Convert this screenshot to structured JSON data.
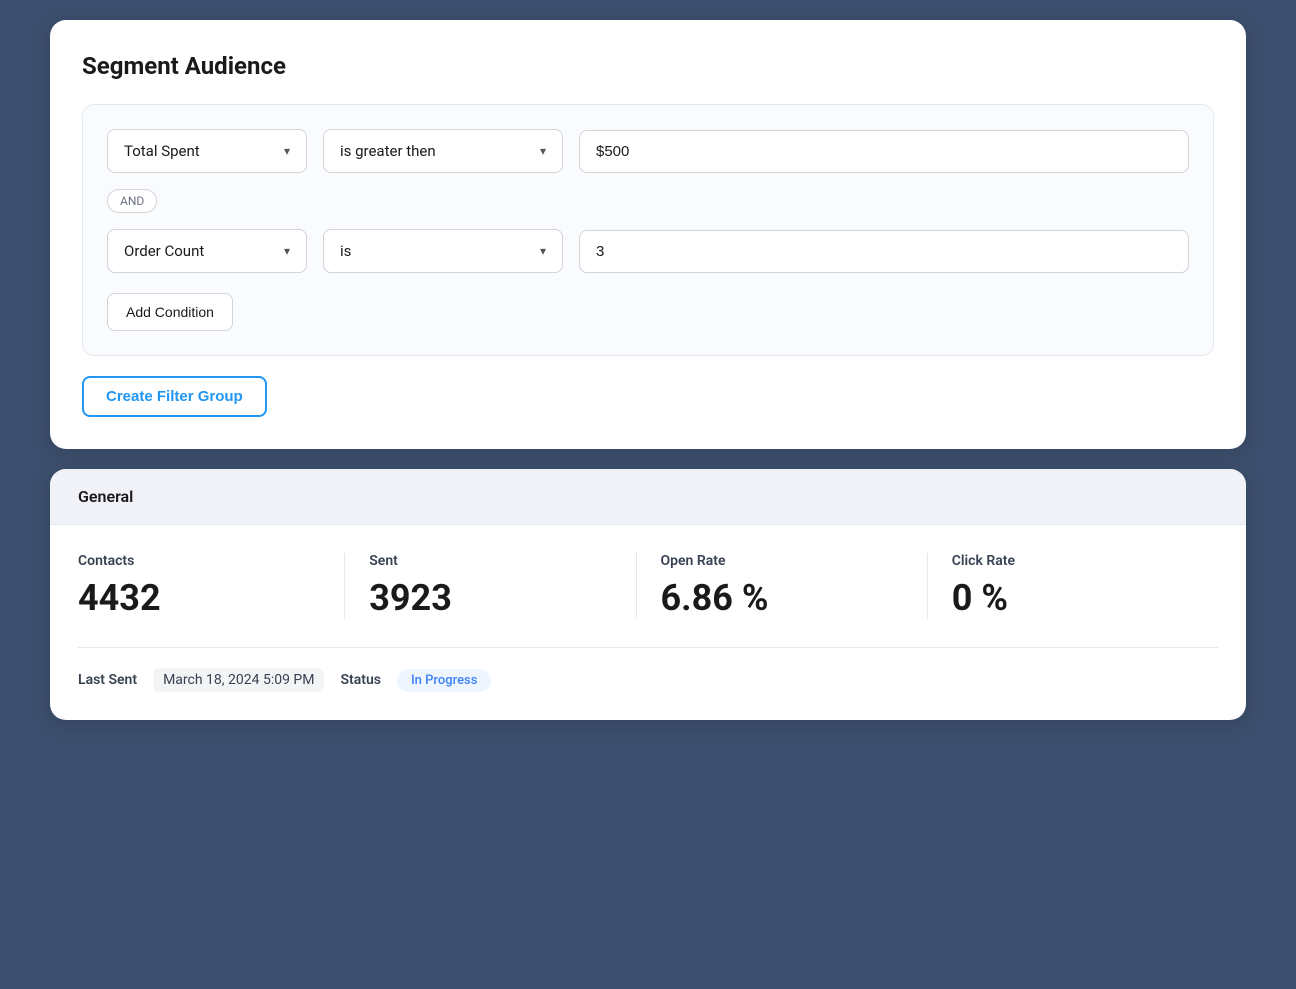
{
  "page": {
    "background_color": "#3d4f6e"
  },
  "segment_audience": {
    "title": "Segment Audience",
    "filter_group": {
      "conditions": [
        {
          "field": "Total Spent",
          "operator": "is greater then",
          "value": "$500"
        },
        {
          "connector": "AND"
        },
        {
          "field": "Order Count",
          "operator": "is",
          "value": "3"
        }
      ]
    },
    "add_condition_label": "Add Condition",
    "create_filter_group_label": "Create Filter Group"
  },
  "general": {
    "section_title": "General",
    "metrics": [
      {
        "label": "Contacts",
        "value": "4432"
      },
      {
        "label": "Sent",
        "value": "3923"
      },
      {
        "label": "Open Rate",
        "value": "6.86 %"
      },
      {
        "label": "Click Rate",
        "value": "0 %"
      }
    ],
    "footer": {
      "last_sent_label": "Last Sent",
      "last_sent_value": "March 18, 2024 5:09 PM",
      "status_label": "Status",
      "status_value": "In Progress"
    }
  },
  "icons": {
    "chevron_down": "▾"
  }
}
